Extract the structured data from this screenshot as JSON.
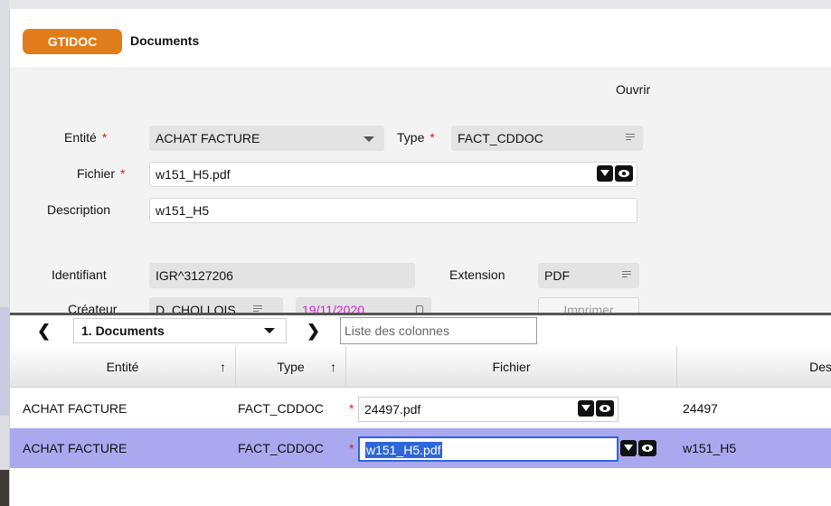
{
  "app": {
    "brand": "GTIDOC",
    "title": "Documents"
  },
  "toolbar": {
    "open_label": "Ouvrir"
  },
  "form": {
    "entity_label": "Entité",
    "entity_value": "ACHAT FACTURE",
    "type_label": "Type",
    "type_value": "FACT_CDDOC",
    "file_label": "Fichier",
    "file_value": "w151_H5.pdf",
    "description_label": "Description",
    "description_value": "w151_H5",
    "id_label": "Identifiant",
    "id_value": "IGR^3127206",
    "extension_label": "Extension",
    "extension_value": "PDF",
    "creator_label": "Créateur",
    "creator_value": "D_CHOLLOIS",
    "date_value": "19/11/2020",
    "print_label": "Imprimer",
    "required_mark": "*"
  },
  "grid": {
    "view_select": "1. Documents",
    "column_search_placeholder": "Liste des colonnes",
    "sort_arrow": "↑",
    "columns": [
      "Entité",
      "Type",
      "Fichier",
      "Des"
    ],
    "rows": [
      {
        "entity": "ACHAT FACTURE",
        "type": "FACT_CDDOC",
        "file": "24497.pdf",
        "desc": "24497",
        "selected": false
      },
      {
        "entity": "ACHAT FACTURE",
        "type": "FACT_CDDOC",
        "file": "w151_H5.pdf",
        "desc": "w151_H5",
        "selected": true
      }
    ]
  },
  "colors": {
    "brand": "#e07d1a",
    "selected_row": "#aaa8ef",
    "required": "#d4201c",
    "date": "#d61fd6"
  },
  "icons": [
    "dropdown-caret-icon",
    "list-icon",
    "download-icon",
    "view-eye-icon",
    "calendar-icon",
    "chevron-left-icon",
    "chevron-right-icon",
    "sort-up-icon"
  ]
}
